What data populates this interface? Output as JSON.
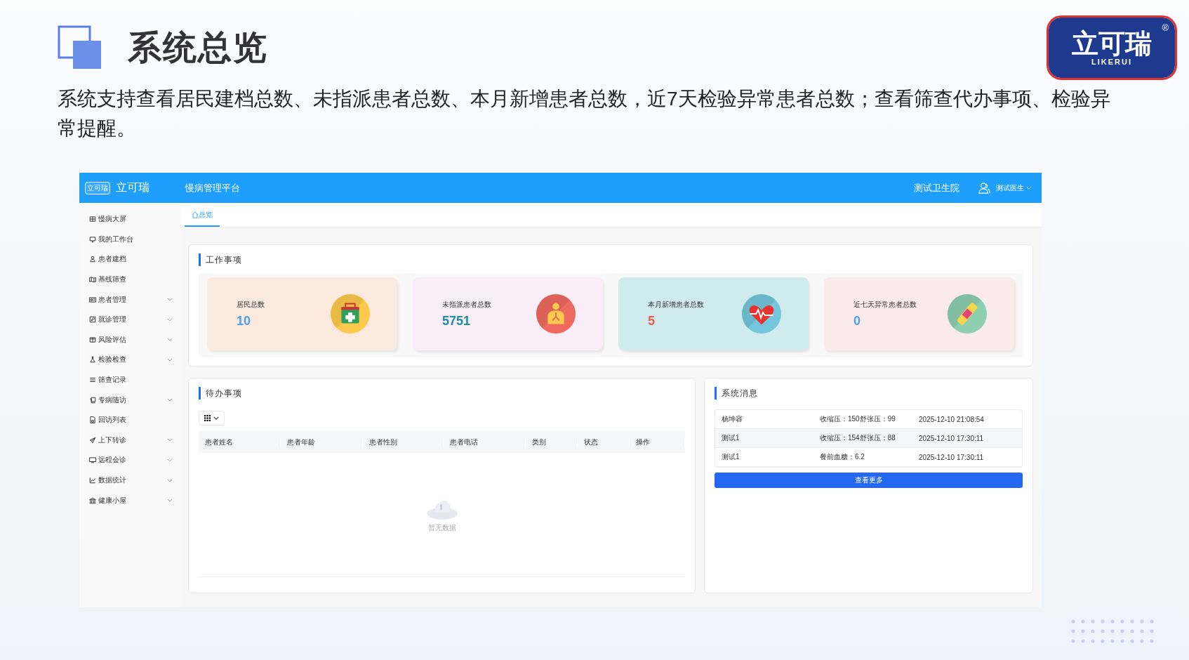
{
  "slide": {
    "title": "系统总览",
    "description": "系统支持查看居民建档总数、未指派患者总数、本月新增患者总数，近7天检验异常患者总数；查看筛查代办事项、检验异常提醒。",
    "logo": {
      "name": "立可瑞",
      "sub": "LIKERUI",
      "mark": "®"
    }
  },
  "app": {
    "brand": "立可瑞",
    "brand_badge": "立可瑞",
    "platform": "慢病管理平台",
    "org": "测试卫生院",
    "user": "测试医生",
    "sidebar": [
      {
        "label": "慢病大屏",
        "expandable": false
      },
      {
        "label": "我的工作台",
        "expandable": false
      },
      {
        "label": "患者建档",
        "expandable": false
      },
      {
        "label": "基线筛查",
        "expandable": false
      },
      {
        "label": "患者管理",
        "expandable": true
      },
      {
        "label": "就诊管理",
        "expandable": true
      },
      {
        "label": "风险评估",
        "expandable": true
      },
      {
        "label": "检验检查",
        "expandable": true
      },
      {
        "label": "筛查记录",
        "expandable": false
      },
      {
        "label": "专病随访",
        "expandable": true
      },
      {
        "label": "回访列表",
        "expandable": false
      },
      {
        "label": "上下转诊",
        "expandable": true
      },
      {
        "label": "远程会诊",
        "expandable": true
      },
      {
        "label": "数据统计",
        "expandable": true
      },
      {
        "label": "健康小屋",
        "expandable": true
      }
    ],
    "tabs": [
      {
        "label": "总览",
        "selected": true
      }
    ],
    "work": {
      "title": "工作事项",
      "cards": [
        {
          "label": "居民总数",
          "value": "10",
          "color": "#fbe9de"
        },
        {
          "label": "未指派患者总数",
          "value": "5751",
          "color": "#f9eef8"
        },
        {
          "label": "本月新增患者总数",
          "value": "5",
          "color": "#cfebee"
        },
        {
          "label": "近七天异常患者总数",
          "value": "0",
          "color": "#fbeaea"
        }
      ]
    },
    "todo": {
      "title": "待办事项",
      "columns": [
        "患者姓名",
        "患者年龄",
        "患者性别",
        "患者电话",
        "类别",
        "状态",
        "操作"
      ],
      "empty": "暂无数据"
    },
    "messages": {
      "title": "系统消息",
      "rows": [
        {
          "name": "杨坤容",
          "content": "收缩压：150舒张压：99",
          "time": "2025-12-10 21:08:54"
        },
        {
          "name": "测试1",
          "content": "收缩压：154舒张压：88",
          "time": "2025-12-10 17:30:11"
        },
        {
          "name": "测试1",
          "content": "餐前血糖：6.2",
          "time": "2025-12-10 17:30:11"
        }
      ],
      "more": "查看更多"
    }
  }
}
